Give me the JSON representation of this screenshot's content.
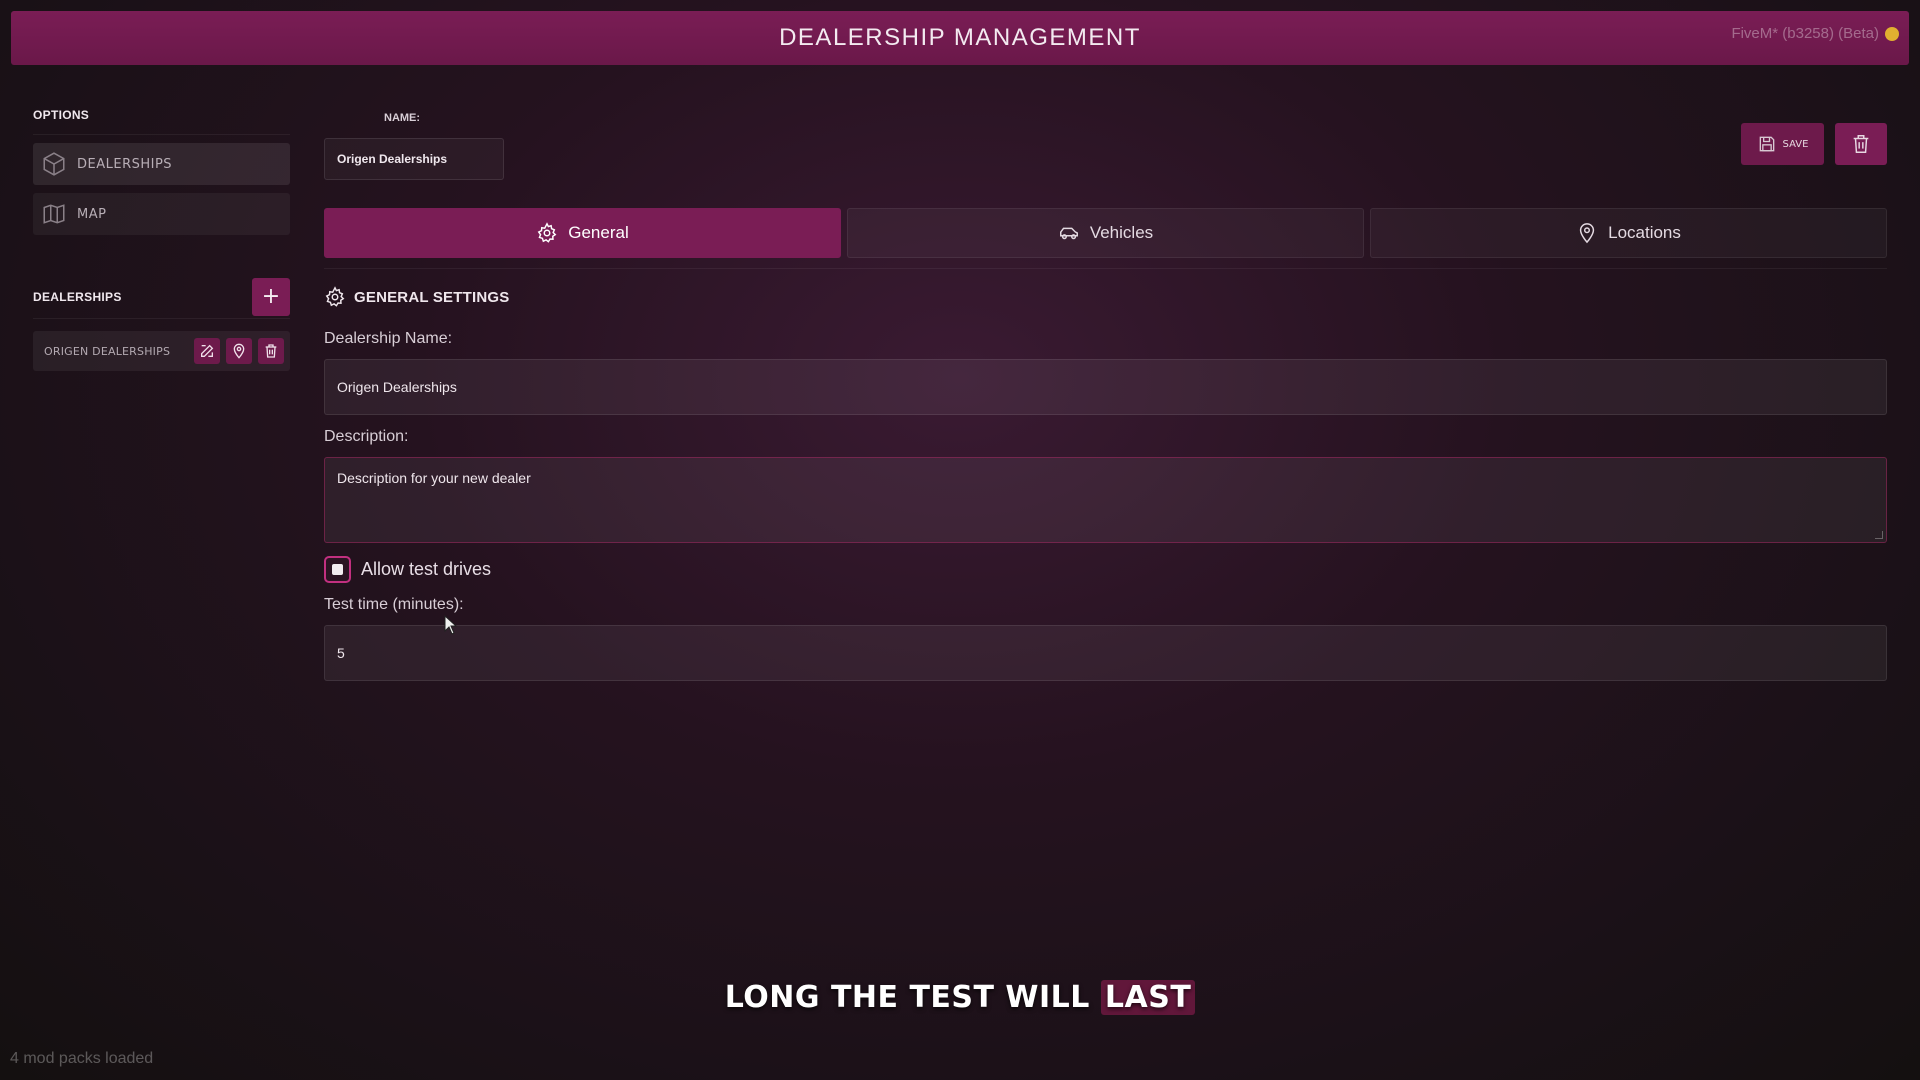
{
  "header": {
    "title": "DEALERSHIP MANAGEMENT",
    "fivem_badge": "FiveM* (b3258) (Beta)"
  },
  "sidebar": {
    "options_title": "OPTIONS",
    "options": [
      {
        "label": "DEALERSHIPS",
        "icon": "cube-icon",
        "active": true
      },
      {
        "label": "MAP",
        "icon": "map-icon",
        "active": false
      }
    ],
    "dealerships_title": "DEALERSHIPS",
    "add_label": "+",
    "dealerships": [
      {
        "label": "ORIGEN DEALERSHIPS"
      }
    ]
  },
  "main": {
    "name_label": "NAME:",
    "name_value": "Origen Dealerships",
    "save_label": "SAVE",
    "tabs": [
      {
        "label": "General",
        "icon": "gear-icon",
        "active": true
      },
      {
        "label": "Vehicles",
        "icon": "car-icon",
        "active": false
      },
      {
        "label": "Locations",
        "icon": "location-pin-icon",
        "active": false
      }
    ],
    "section_title": "GENERAL SETTINGS",
    "dealership_name_label": "Dealership Name:",
    "dealership_name_value": "Origen Dealerships",
    "description_label": "Description:",
    "description_value": "Description for your new dealer",
    "allow_test_drives_label": "Allow test drives",
    "allow_test_drives_checked": true,
    "test_time_label": "Test time (minutes):",
    "test_time_value": "5"
  },
  "overlay": {
    "subtitle_pre": "LONG THE TEST WILL",
    "subtitle_highlight": "LAST",
    "mods_loaded": "4 mod packs loaded"
  },
  "colors": {
    "accent": "#7a1d55",
    "checkbox_border": "#c23080"
  }
}
